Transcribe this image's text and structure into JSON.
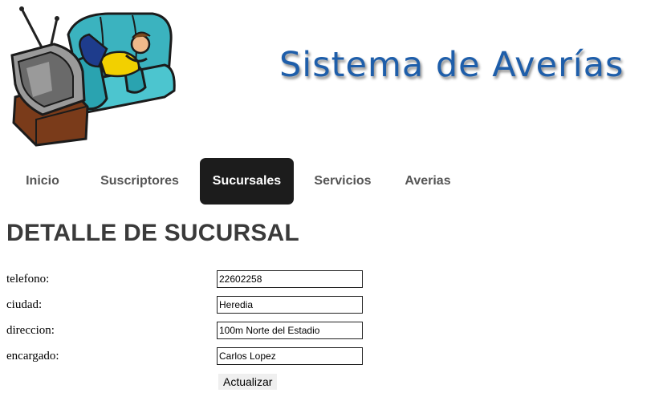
{
  "header": {
    "site_title": "Sistema de Averías",
    "logo_icon": "couch-tv-icon"
  },
  "nav": {
    "items": [
      {
        "label": "Inicio",
        "active": false
      },
      {
        "label": "Suscriptores",
        "active": false
      },
      {
        "label": "Sucursales",
        "active": true
      },
      {
        "label": "Servicios",
        "active": false
      },
      {
        "label": "Averias",
        "active": false
      }
    ]
  },
  "main": {
    "title": "DETALLE DE SUCURSAL",
    "fields": [
      {
        "label": "telefono:",
        "value": "22602258"
      },
      {
        "label": "ciudad:",
        "value": "Heredia"
      },
      {
        "label": "direccion:",
        "value": "100m Norte del Estadio"
      },
      {
        "label": "encargado:",
        "value": "Carlos Lopez"
      }
    ],
    "submit_label": "Actualizar"
  },
  "colors": {
    "title_blue": "#1e5eaa",
    "nav_active_bg": "#1c1c1c",
    "nav_text": "#555555"
  }
}
